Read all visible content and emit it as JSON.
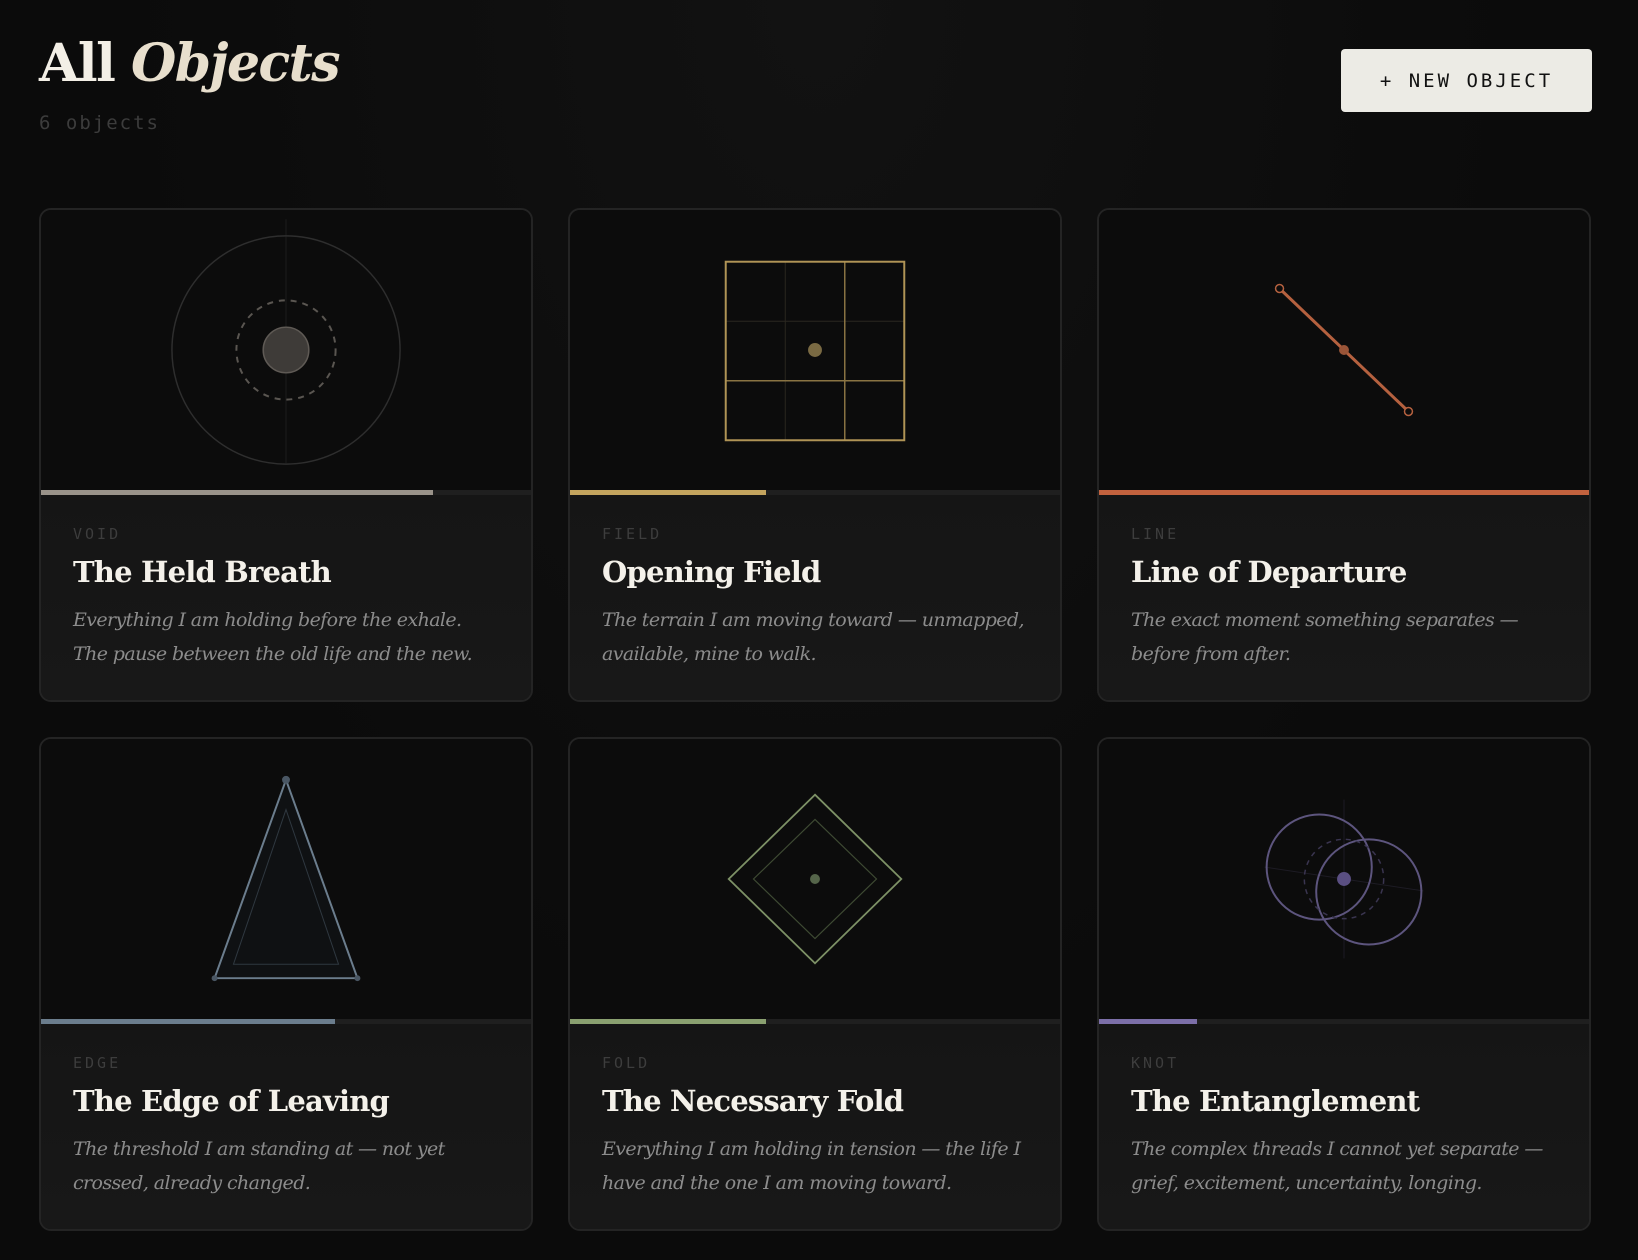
{
  "header": {
    "title_plain": "All",
    "title_italic": "Objects",
    "count_text": "6 objects",
    "new_button_label": "+ NEW OBJECT"
  },
  "colors": {
    "background": "#0b0b0b",
    "void": "#9a938a",
    "field": "#c4a45e",
    "line": "#c2623e",
    "edge": "#6b7d8d",
    "fold": "#8aa070",
    "knot": "#7c6fa8"
  },
  "objects": [
    {
      "type": "VOID",
      "title": "The Held Breath",
      "description": "Everything I am holding before the exhale. The pause between the old life and the new.",
      "progress": 0.8,
      "accent": "#9a938a",
      "icon": "concentric-circles-icon"
    },
    {
      "type": "FIELD",
      "title": "Opening Field",
      "description": "The terrain I am moving toward — unmapped, available, mine to walk.",
      "progress": 0.4,
      "accent": "#c4a45e",
      "icon": "grid-square-icon"
    },
    {
      "type": "LINE",
      "title": "Line of Departure",
      "description": "The exact moment something separates — before from after.",
      "progress": 1.0,
      "accent": "#c2623e",
      "icon": "diagonal-line-icon"
    },
    {
      "type": "EDGE",
      "title": "The Edge of Leaving",
      "description": "The threshold I am standing at — not yet crossed, already changed.",
      "progress": 0.6,
      "accent": "#6b7d8d",
      "icon": "triangle-icon"
    },
    {
      "type": "FOLD",
      "title": "The Necessary Fold",
      "description": "Everything I am holding in tension — the life I have and the one I am moving toward.",
      "progress": 0.4,
      "accent": "#8aa070",
      "icon": "diamond-icon"
    },
    {
      "type": "KNOT",
      "title": "The Entanglement",
      "description": "The complex threads I cannot yet separate — grief, excitement, uncertainty, longing.",
      "progress": 0.2,
      "accent": "#7c6fa8",
      "icon": "interlocking-circles-icon"
    }
  ]
}
